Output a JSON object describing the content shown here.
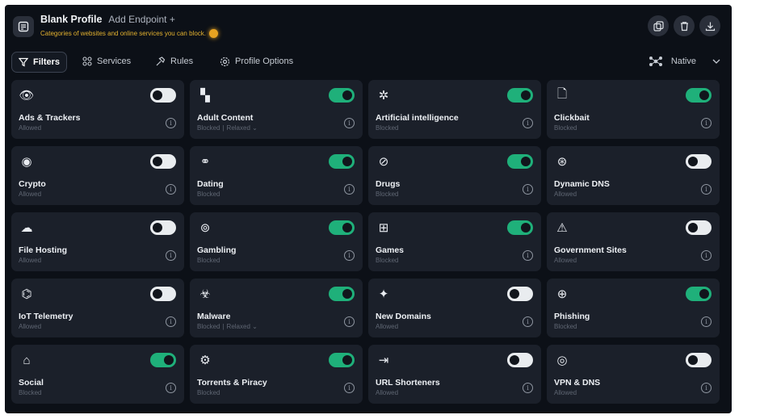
{
  "header": {
    "profile_name": "Blank Profile",
    "add_endpoint": "Add Endpoint +",
    "subtitle": "Categories of websites and online services you can block."
  },
  "toolbar": {
    "filters": "Filters",
    "services": "Services",
    "rules": "Rules",
    "profile_options": "Profile Options",
    "native": "Native"
  },
  "colors": {
    "enabled": "#1fb07a",
    "disabled": "#e9ecef",
    "accent": "#e8a321"
  },
  "categories": [
    {
      "label": "Ads & Trackers",
      "status": "Allowed",
      "extra": "",
      "enabled": false,
      "icon": "eye-icon"
    },
    {
      "label": "Adult Content",
      "status": "Blocked",
      "extra": "Relaxed",
      "enabled": true,
      "icon": "pixels-icon"
    },
    {
      "label": "Artificial intelligence",
      "status": "Blocked",
      "extra": "",
      "enabled": true,
      "icon": "ai-sparkle-icon"
    },
    {
      "label": "Clickbait",
      "status": "Blocked",
      "extra": "",
      "enabled": true,
      "icon": "clickbait-icon"
    },
    {
      "label": "Crypto",
      "status": "Allowed",
      "extra": "",
      "enabled": false,
      "icon": "coin-icon"
    },
    {
      "label": "Dating",
      "status": "Blocked",
      "extra": "",
      "enabled": true,
      "icon": "dating-icon"
    },
    {
      "label": "Drugs",
      "status": "Blocked",
      "extra": "",
      "enabled": true,
      "icon": "pill-icon"
    },
    {
      "label": "Dynamic DNS",
      "status": "Allowed",
      "extra": "",
      "enabled": false,
      "icon": "globe-icon"
    },
    {
      "label": "File Hosting",
      "status": "Allowed",
      "extra": "",
      "enabled": false,
      "icon": "cloud-upload-icon"
    },
    {
      "label": "Gambling",
      "status": "Blocked",
      "extra": "",
      "enabled": true,
      "icon": "roulette-icon"
    },
    {
      "label": "Games",
      "status": "Blocked",
      "extra": "",
      "enabled": true,
      "icon": "gamepad-icon"
    },
    {
      "label": "Government Sites",
      "status": "Allowed",
      "extra": "",
      "enabled": false,
      "icon": "government-icon"
    },
    {
      "label": "IoT Telemetry",
      "status": "Allowed",
      "extra": "",
      "enabled": false,
      "icon": "satellite-dish-icon"
    },
    {
      "label": "Malware",
      "status": "Blocked",
      "extra": "Relaxed",
      "enabled": true,
      "icon": "biohazard-icon"
    },
    {
      "label": "New Domains",
      "status": "Allowed",
      "extra": "",
      "enabled": false,
      "icon": "new-domain-icon"
    },
    {
      "label": "Phishing",
      "status": "Blocked",
      "extra": "",
      "enabled": true,
      "icon": "fishing-net-icon"
    },
    {
      "label": "Social",
      "status": "Blocked",
      "extra": "",
      "enabled": true,
      "icon": "megaphone-icon"
    },
    {
      "label": "Torrents & Piracy",
      "status": "Blocked",
      "extra": "",
      "enabled": true,
      "icon": "torrent-icon"
    },
    {
      "label": "URL Shorteners",
      "status": "Allowed",
      "extra": "",
      "enabled": false,
      "icon": "redirect-icon"
    },
    {
      "label": "VPN & DNS",
      "status": "Allowed",
      "extra": "",
      "enabled": false,
      "icon": "vpn-icon"
    }
  ]
}
